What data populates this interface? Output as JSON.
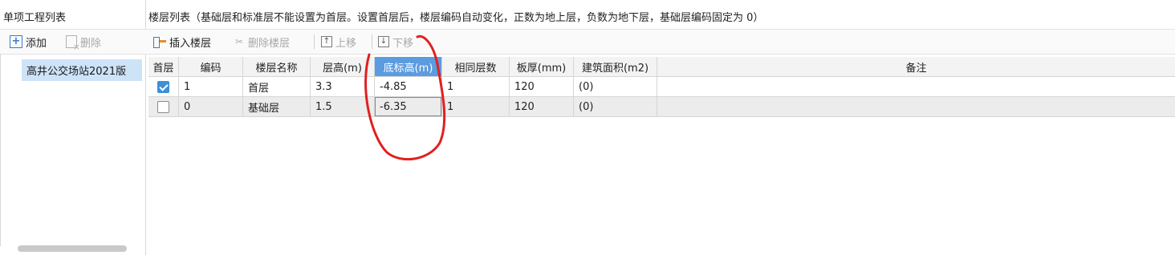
{
  "left": {
    "title": "单项工程列表",
    "toolbar": {
      "add_label": "添加",
      "delete_label": "删除"
    },
    "projects": [
      "高井公交场站2021版"
    ]
  },
  "right": {
    "title": "楼层列表（基础层和标准层不能设置为首层。设置首层后，楼层编码自动变化，正数为地上层，负数为地下层，基础层编码固定为 0）",
    "toolbar": {
      "insert_label": "插入楼层",
      "remove_label": "删除楼层",
      "up_label": "上移",
      "down_label": "下移"
    }
  },
  "table": {
    "headers": [
      "首层",
      "编码",
      "楼层名称",
      "层高(m)",
      "底标高(m)",
      "相同层数",
      "板厚(mm)",
      "建筑面积(m2)",
      "备注"
    ],
    "rows": [
      {
        "first_floor": true,
        "code": "1",
        "name": "首层",
        "height": "3.3",
        "bottom_elev": "-4.85",
        "same_count": "1",
        "slab": "120",
        "area": "(0)",
        "note": ""
      },
      {
        "first_floor": false,
        "code": "0",
        "name": "基础层",
        "height": "1.5",
        "bottom_elev": "-6.35",
        "same_count": "1",
        "slab": "120",
        "area": "(0)",
        "note": ""
      }
    ]
  },
  "colors": {
    "selected_header": "#5b9be0",
    "selected_row": "#cde3f8",
    "annotation_red": "#e02020"
  }
}
